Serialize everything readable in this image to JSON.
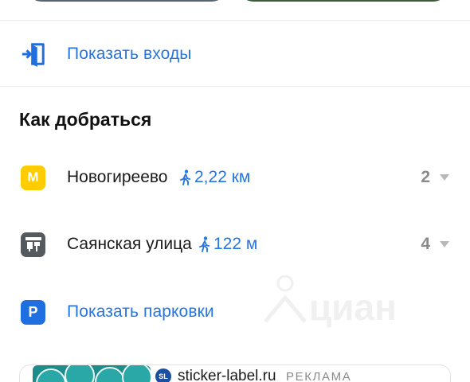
{
  "entrances": {
    "label": "Показать входы",
    "icon": "entrance-icon"
  },
  "how_to_get": {
    "title": "Как добраться",
    "stations": [
      {
        "badge": "М",
        "type": "metro",
        "name": "Новогиреево",
        "distance": "2,22 км",
        "count": "2"
      },
      {
        "badge": "",
        "type": "bus",
        "name": "Саянская улица",
        "distance": "122 м",
        "count": "4"
      }
    ]
  },
  "parking": {
    "badge": "P",
    "label": "Показать парковки"
  },
  "ad": {
    "logo": "SL",
    "domain": "sticker-label.ru",
    "label": "РЕКЛАМА"
  },
  "colors": {
    "link": "#2775e0",
    "metro_badge": "#ffcc00",
    "bus_badge": "#555a5e",
    "parking_badge": "#1f6fe0"
  }
}
